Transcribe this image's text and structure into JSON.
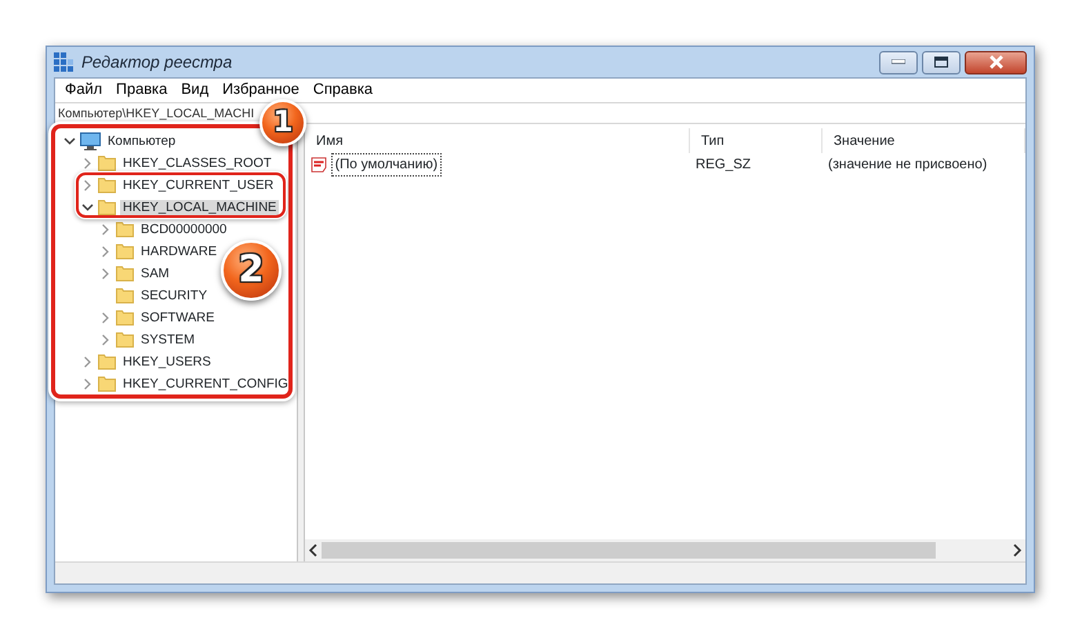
{
  "window": {
    "title": "Редактор реестра"
  },
  "menu": [
    "Файл",
    "Правка",
    "Вид",
    "Избранное",
    "Справка"
  ],
  "address": "Компьютер\\HKEY_LOCAL_MACHI",
  "tree": [
    {
      "label": "Компьютер",
      "kind": "computer",
      "expandable": true,
      "expanded": true,
      "selected": false,
      "children": [
        {
          "label": "HKEY_CLASSES_ROOT",
          "kind": "folder",
          "expandable": true,
          "expanded": false,
          "selected": false
        },
        {
          "label": "HKEY_CURRENT_USER",
          "kind": "folder",
          "expandable": true,
          "expanded": false,
          "selected": false
        },
        {
          "label": "HKEY_LOCAL_MACHINE",
          "kind": "folder",
          "expandable": true,
          "expanded": true,
          "selected": true,
          "children": [
            {
              "label": "BCD00000000",
              "kind": "folder",
              "expandable": true,
              "expanded": false,
              "selected": false
            },
            {
              "label": "HARDWARE",
              "kind": "folder",
              "expandable": true,
              "expanded": false,
              "selected": false
            },
            {
              "label": "SAM",
              "kind": "folder",
              "expandable": true,
              "expanded": false,
              "selected": false
            },
            {
              "label": "SECURITY",
              "kind": "folder",
              "expandable": false,
              "selected": false
            },
            {
              "label": "SOFTWARE",
              "kind": "folder",
              "expandable": true,
              "expanded": false,
              "selected": false
            },
            {
              "label": "SYSTEM",
              "kind": "folder",
              "expandable": true,
              "expanded": false,
              "selected": false
            }
          ]
        },
        {
          "label": "HKEY_USERS",
          "kind": "folder",
          "expandable": true,
          "expanded": false,
          "selected": false
        },
        {
          "label": "HKEY_CURRENT_CONFIG",
          "kind": "folder",
          "expandable": true,
          "expanded": false,
          "selected": false
        }
      ]
    }
  ],
  "list": {
    "columns": [
      "Имя",
      "Тип",
      "Значение"
    ],
    "rows": [
      {
        "kind": "string",
        "name": "(По умолчанию)",
        "type": "REG_SZ",
        "value": "(значение не присвоено)",
        "focused": true
      }
    ]
  },
  "callouts": [
    {
      "label": "1"
    },
    {
      "label": "2"
    }
  ]
}
